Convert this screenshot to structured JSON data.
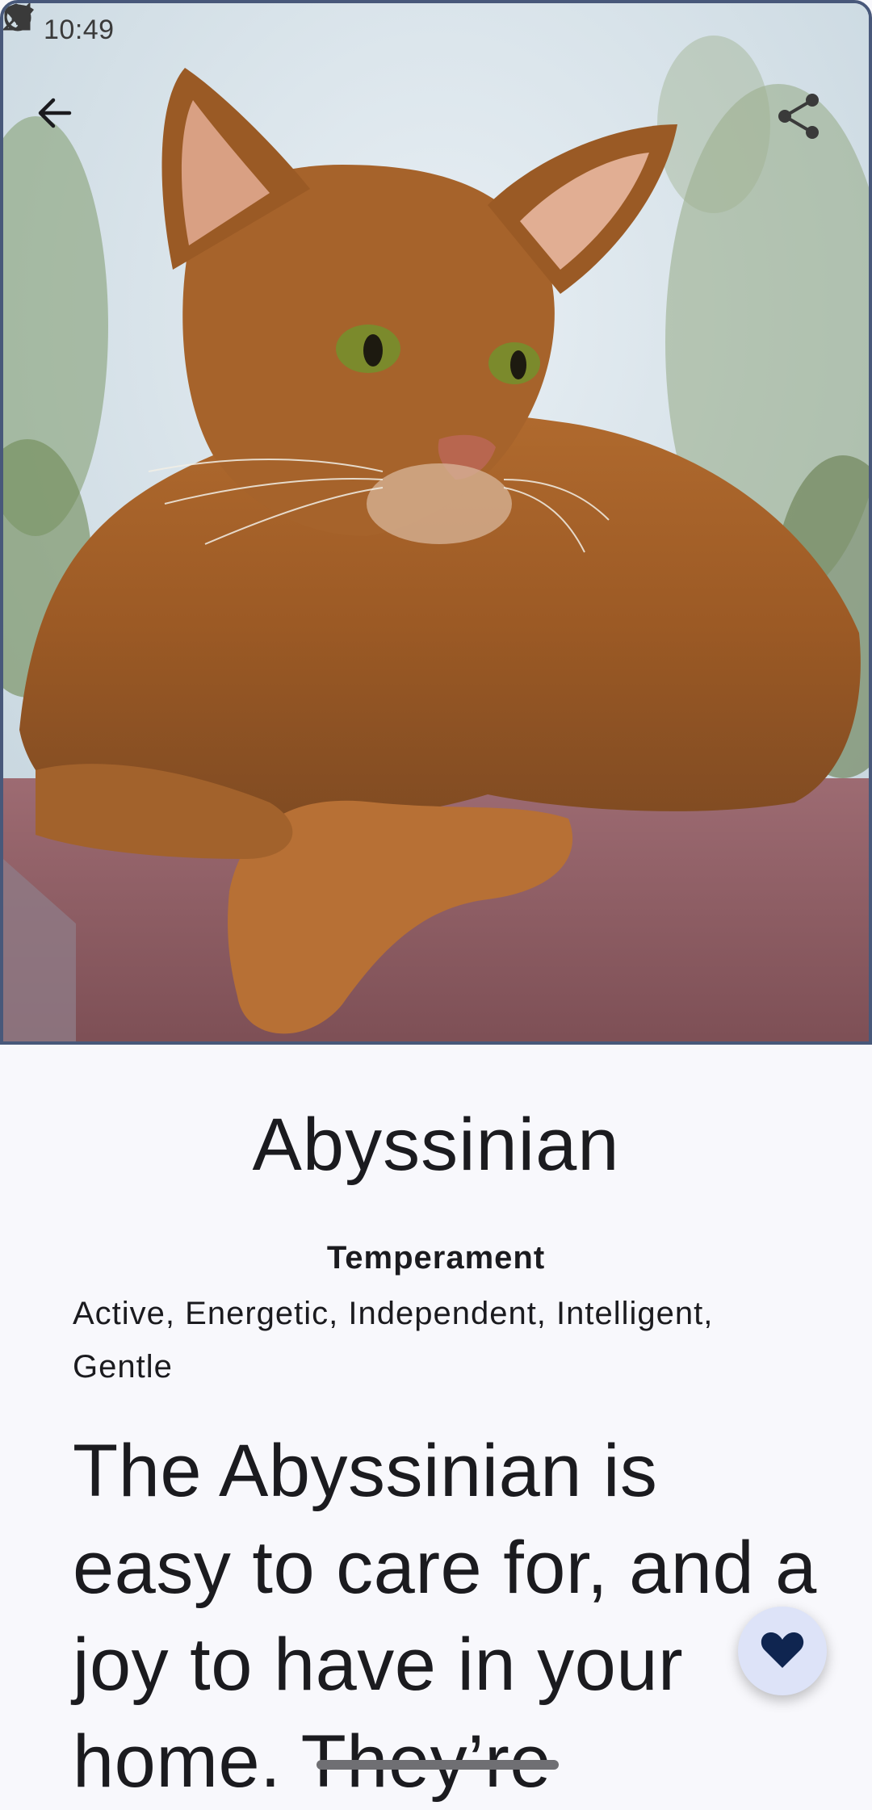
{
  "status_bar": {
    "time": "10:49",
    "icons": [
      "shield-icon",
      "face-icon",
      "wifi-icon",
      "signal-icon"
    ]
  },
  "toolbar": {
    "back_icon": "arrow-back-icon",
    "share_icon": "share-icon"
  },
  "hero": {
    "image": "abyssinian-cat-photo"
  },
  "breed": {
    "name": "Abyssinian",
    "temperament_label": "Temperament",
    "temperament_value": "Active, Energetic, Independent, Intelligent, Gentle",
    "description": "The Abyssinian is easy to care for, and a joy to have in your home. They’re"
  },
  "fab": {
    "icon": "heart-icon"
  },
  "colors": {
    "background": "#f8f8fc",
    "text": "#1b1b1f",
    "fab_background": "#dde3f8",
    "fab_icon": "#0f2550",
    "hero_border": "#48587a"
  }
}
